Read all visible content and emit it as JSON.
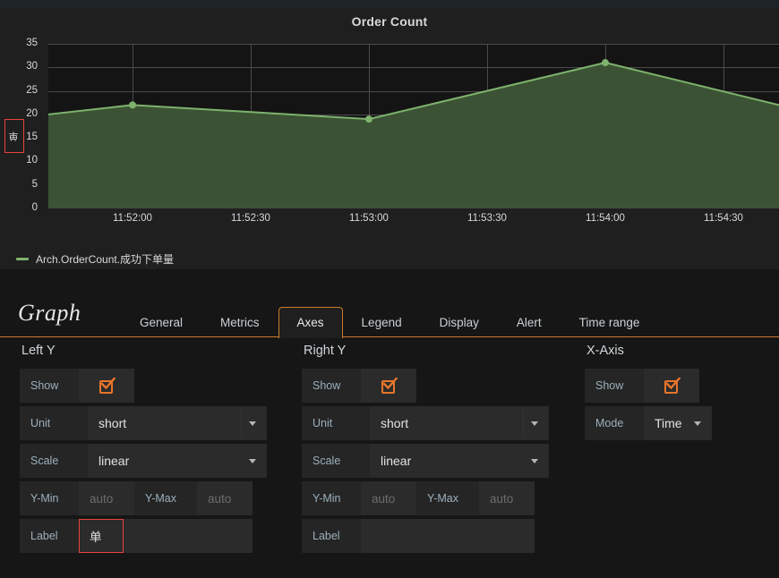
{
  "panel": {
    "title": "Order Count",
    "y_axis_label": "单",
    "legend": [
      {
        "label": "Arch.OrderCount.成功下单量",
        "color": "#7eb26d"
      }
    ]
  },
  "chart_data": {
    "type": "area",
    "title": "Order Count",
    "xlabel": "",
    "ylabel": "单",
    "ylim": [
      0,
      35
    ],
    "y_ticks": [
      0,
      5,
      10,
      15,
      20,
      25,
      30,
      35
    ],
    "x_ticks": [
      "11:52:00",
      "11:52:30",
      "11:53:00",
      "11:53:30",
      "11:54:00",
      "11:54:30"
    ],
    "grid": true,
    "legend_position": "bottom-left",
    "series": [
      {
        "name": "Arch.OrderCount.成功下单量",
        "color": "#7eb26d",
        "fill_color": "#3b5334",
        "x": [
          "11:51:40",
          "11:52:00",
          "11:53:00",
          "11:54:00",
          "11:55:00"
        ],
        "values": [
          20,
          22,
          19,
          31,
          22
        ]
      }
    ]
  },
  "editor": {
    "kind": "Graph",
    "tabs": [
      {
        "label": "General",
        "active": false
      },
      {
        "label": "Metrics",
        "active": false
      },
      {
        "label": "Axes",
        "active": true
      },
      {
        "label": "Legend",
        "active": false
      },
      {
        "label": "Display",
        "active": false
      },
      {
        "label": "Alert",
        "active": false
      },
      {
        "label": "Time range",
        "active": false
      }
    ],
    "left_y": {
      "title": "Left Y",
      "show_label": "Show",
      "show_checked": true,
      "unit_label": "Unit",
      "unit_value": "short",
      "scale_label": "Scale",
      "scale_value": "linear",
      "ymin_label": "Y-Min",
      "ymin_placeholder": "auto",
      "ymin_value": "",
      "ymax_label": "Y-Max",
      "ymax_placeholder": "auto",
      "ymax_value": "",
      "label_label": "Label",
      "label_value": "单"
    },
    "right_y": {
      "title": "Right Y",
      "show_label": "Show",
      "show_checked": true,
      "unit_label": "Unit",
      "unit_value": "short",
      "scale_label": "Scale",
      "scale_value": "linear",
      "ymin_label": "Y-Min",
      "ymin_placeholder": "auto",
      "ymin_value": "",
      "ymax_label": "Y-Max",
      "ymax_placeholder": "auto",
      "ymax_value": "",
      "label_label": "Label",
      "label_value": ""
    },
    "x_axis": {
      "title": "X-Axis",
      "show_label": "Show",
      "show_checked": true,
      "mode_label": "Mode",
      "mode_value": "Time"
    }
  },
  "colors": {
    "accent": "#cc7a29",
    "checkbox": "#e8752b",
    "highlight": "#e8433a",
    "series": "#7eb26d",
    "panel_bg": "#1f1f1f",
    "plot_bg": "#141414"
  }
}
